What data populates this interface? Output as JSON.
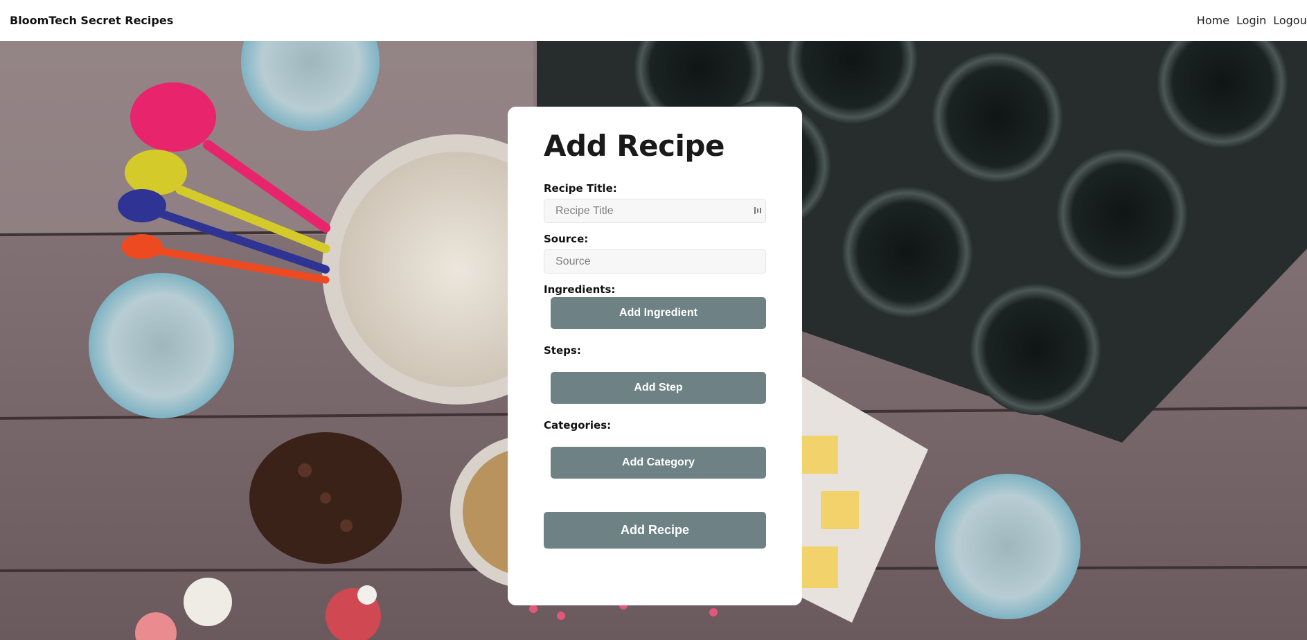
{
  "nav": {
    "brand": "BloomTech Secret Recipes",
    "links": [
      "Home",
      "Login",
      "Logout"
    ]
  },
  "form": {
    "title": "Add Recipe",
    "recipe_title_label": "Recipe Title:",
    "recipe_title_placeholder": "Recipe Title",
    "source_label": "Source:",
    "source_placeholder": "Source",
    "ingredients_label": "Ingredients:",
    "add_ingredient": "Add Ingredient",
    "steps_label": "Steps:",
    "add_step": "Add Step",
    "categories_label": "Categories:",
    "add_category": "Add Category",
    "submit": "Add Recipe"
  },
  "colors": {
    "button": "#6e8285",
    "card": "#ffffff",
    "nav": "#ffffff"
  },
  "background": {
    "description_icon": "baking-table-photo"
  }
}
